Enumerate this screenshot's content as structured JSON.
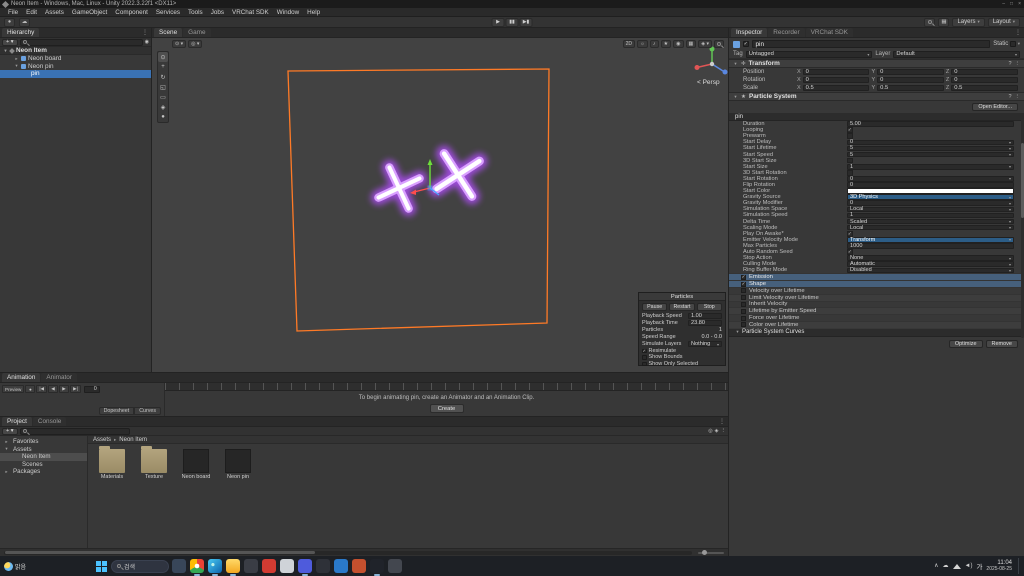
{
  "colors": {
    "selection": "#3a72b4",
    "unity_orange": "#ff7a26",
    "neon_glow": "#b44dff",
    "taskbar_bg": "#1d2025",
    "scene_bg": "#424242"
  },
  "window": {
    "title": "Neon Item - Windows, Mac, Linux - Unity 2022.3.22f1 <DX11>",
    "minimize": "–",
    "maximize": "□",
    "close": "×",
    "menu": [
      {
        "label": "File"
      },
      {
        "label": "Edit"
      },
      {
        "label": "Assets"
      },
      {
        "label": "GameObject"
      },
      {
        "label": "Component"
      },
      {
        "label": "Services"
      },
      {
        "label": "Tools"
      },
      {
        "label": "Jobs"
      },
      {
        "label": "VRChat SDK"
      },
      {
        "label": "Window"
      },
      {
        "label": "Help"
      }
    ]
  },
  "toolbar": {
    "layers": "Layers",
    "layout": "Layout"
  },
  "hierarchy": {
    "tab": "Hierarchy",
    "scene_name": "Neon Item",
    "items": [
      {
        "label": "Neon board",
        "arrow": "▸",
        "icon": "cube",
        "indent": "ind1"
      },
      {
        "label": "Neon pin",
        "arrow": "▾",
        "icon": "cube",
        "indent": "ind1"
      },
      {
        "label": "pin",
        "arrow": "",
        "icon": "ps",
        "indent": "ind2",
        "selected": "sel"
      }
    ]
  },
  "scene": {
    "tabs": [
      {
        "label": "Scene",
        "state": "active"
      },
      {
        "label": "Game"
      }
    ],
    "toolbar_2d": "2D",
    "persp": "< Persp"
  },
  "particles": {
    "title": "Particles",
    "buttons": [
      {
        "label": "Pause"
      },
      {
        "label": "Restart"
      },
      {
        "label": "Stop"
      }
    ],
    "rows": [
      {
        "label": "Playback Speed",
        "value": "1.00",
        "kind": "field"
      },
      {
        "label": "Playback Time",
        "value": "23.80",
        "kind": "field"
      },
      {
        "label": "Particles",
        "value": "1",
        "kind": "plain"
      },
      {
        "label": "Speed Range",
        "value": "0.0 - 0.0",
        "kind": "plain"
      },
      {
        "label": "Simulate Layers",
        "value": "Nothing",
        "kind": "menu"
      }
    ],
    "checks": [
      {
        "label": "Resimulate",
        "state": "on"
      },
      {
        "label": "Show Bounds",
        "state": "off"
      },
      {
        "label": "Show Only Selected",
        "state": "off"
      }
    ]
  },
  "animation": {
    "tabs": [
      {
        "label": "Animation",
        "state": "active"
      },
      {
        "label": "Animator"
      }
    ],
    "preview": "Preview",
    "frame": "0",
    "message": "To begin animating pin, create an Animator and an Animation Clip.",
    "create": "Create",
    "dopesheet": "Dopesheet",
    "curves": "Curves"
  },
  "project": {
    "tabs": [
      {
        "label": "Project",
        "state": "active"
      },
      {
        "label": "Console"
      }
    ],
    "breadcrumb": {
      "root": "Assets",
      "sep": "▸",
      "current": "Neon Item"
    },
    "tree": [
      {
        "label": "Favorites",
        "arrow": "▸",
        "icon": "star",
        "indent": "ind0"
      },
      {
        "label": "Assets",
        "arrow": "▾",
        "icon": "folder",
        "indent": "ind0"
      },
      {
        "label": "Neon Item",
        "arrow": "",
        "icon": "folder",
        "indent": "ind1",
        "selected": "sel"
      },
      {
        "label": "Scenes",
        "arrow": "",
        "icon": "folder",
        "indent": "ind1"
      },
      {
        "label": "Packages",
        "arrow": "▸",
        "icon": "folder",
        "indent": "ind0"
      }
    ],
    "items": [
      {
        "label": "Materials",
        "kind": "folder"
      },
      {
        "label": "Texture",
        "kind": "folder"
      },
      {
        "label": "Neon board",
        "kind": "prefab"
      },
      {
        "label": "Neon pin",
        "kind": "prefab"
      }
    ]
  },
  "inspector": {
    "tabs": [
      {
        "label": "Inspector",
        "state": "active"
      },
      {
        "label": "Recorder"
      },
      {
        "label": "VRChat SDK"
      }
    ],
    "name": "pin",
    "static_label": "Static",
    "tag_label": "Tag",
    "tag_value": "Untagged",
    "layer_label": "Layer",
    "layer_value": "Default",
    "transform": {
      "title": "Transform",
      "ax_x": "X",
      "ax_y": "Y",
      "ax_z": "Z",
      "rows": [
        {
          "label": "Position",
          "x": "0",
          "y": "0",
          "z": "0"
        },
        {
          "label": "Rotation",
          "x": "0",
          "y": "0",
          "z": "0"
        },
        {
          "label": "Scale",
          "x": "0.5",
          "y": "0.5",
          "z": "0.5"
        }
      ]
    },
    "ps": {
      "title": "Particle System",
      "open_editor": "Open Editor...",
      "emitter_name": "pin",
      "rows": [
        {
          "label": "Duration",
          "value": "5.00",
          "kind": "field"
        },
        {
          "label": "Looping",
          "kind": "check",
          "state": "on"
        },
        {
          "label": "Prewarm",
          "kind": "check",
          "state": "off"
        },
        {
          "label": "Start Delay",
          "value": "0",
          "kind": "menufield"
        },
        {
          "label": "Start Lifetime",
          "value": "5",
          "kind": "menufield"
        },
        {
          "label": "Start Speed",
          "value": "5",
          "kind": "menufield"
        },
        {
          "label": "3D Start Size",
          "kind": "check",
          "state": "off"
        },
        {
          "label": "Start Size",
          "value": "1",
          "kind": "menufield"
        },
        {
          "label": "3D Start Rotation",
          "kind": "check",
          "state": "off"
        },
        {
          "label": "Start Rotation",
          "value": "0",
          "kind": "menufield"
        },
        {
          "label": "Flip Rotation",
          "value": "0",
          "kind": "field"
        },
        {
          "label": "Start Color",
          "kind": "color"
        },
        {
          "label": "Gravity Source",
          "value": "3D Physics",
          "kind": "menu",
          "hl": "hl"
        },
        {
          "label": "Gravity Modifier",
          "value": "0",
          "kind": "menufield"
        },
        {
          "label": "Simulation Space",
          "value": "Local",
          "kind": "menu"
        },
        {
          "label": "Simulation Speed",
          "value": "1",
          "kind": "field"
        },
        {
          "label": "Delta Time",
          "value": "Scaled",
          "kind": "menu"
        },
        {
          "label": "Scaling Mode",
          "value": "Local",
          "kind": "menu"
        },
        {
          "label": "Play On Awake*",
          "kind": "check",
          "state": "on"
        },
        {
          "label": "Emitter Velocity Mode",
          "value": "Transform",
          "kind": "menu",
          "hl": "hl"
        },
        {
          "label": "Max Particles",
          "value": "1000",
          "kind": "field"
        },
        {
          "label": "Auto Random Seed",
          "kind": "check",
          "state": "on"
        },
        {
          "label": "Stop Action",
          "value": "None",
          "kind": "menu"
        },
        {
          "label": "Culling Mode",
          "value": "Automatic",
          "kind": "menu"
        },
        {
          "label": "Ring Buffer Mode",
          "value": "Disabled",
          "kind": "menu"
        }
      ],
      "modules": [
        {
          "label": "Emission",
          "state": "on"
        },
        {
          "label": "Shape",
          "state": "on"
        },
        {
          "label": "Velocity over Lifetime",
          "state": "off"
        },
        {
          "label": "Limit Velocity over Lifetime",
          "state": "off"
        },
        {
          "label": "Inherit Velocity",
          "state": "off"
        },
        {
          "label": "Lifetime by Emitter Speed",
          "state": "off"
        },
        {
          "label": "Force over Lifetime",
          "state": "off"
        },
        {
          "label": "Color over Lifetime",
          "state": "off"
        }
      ],
      "curves_title": "Particle System Curves",
      "optimize": "Optimize",
      "remove": "Remove"
    }
  },
  "taskbar": {
    "weather": "맑음",
    "search": "검색",
    "apps": [
      {
        "name": "task-view-button",
        "bg": "#384659"
      },
      {
        "name": "app-chrome",
        "bg": "radial-gradient(circle,#fff 0 2.2px,transparent 2.4px),conic-gradient(#ea4335 0 120deg,#34a853 0 240deg,#fbbc05 0 360deg)",
        "open": "open"
      },
      {
        "name": "app-edge",
        "bg": "radial-gradient(circle at 35% 40%,#b9f0e8 0 1.5px,transparent 1.8px),linear-gradient(135deg,#49c9f2,#0c63ad)",
        "open": "open"
      },
      {
        "name": "file-explorer",
        "bg": "linear-gradient(180deg,#ffd969,#f3a821)",
        "open": "open"
      },
      {
        "name": "app-dark-1",
        "bg": "#3a3d45"
      },
      {
        "name": "app-red",
        "bg": "#d23b32"
      },
      {
        "name": "app-light",
        "bg": "#cfd3d8"
      },
      {
        "name": "app-discord",
        "bg": "#4e5bdc",
        "open": "open"
      },
      {
        "name": "app-dark-2",
        "bg": "#2e3138"
      },
      {
        "name": "app-vscode",
        "bg": "#2a79c9"
      },
      {
        "name": "app-orange",
        "bg": "#c4502e"
      },
      {
        "name": "app-unity",
        "bg": "#20232a",
        "open": "open"
      },
      {
        "name": "app-dark-3",
        "bg": "#43474f"
      }
    ],
    "tray": {
      "chevron": "∧",
      "ime": "가",
      "time": "11:04",
      "date": "2025-08-25"
    }
  }
}
